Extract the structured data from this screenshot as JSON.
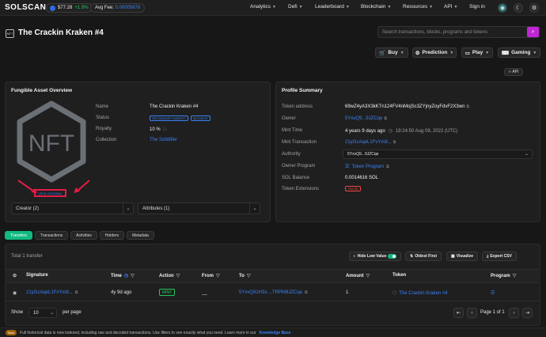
{
  "nav": {
    "logo": "SOLSCAN",
    "sol_price": "$77.28",
    "sol_change": "+1.9%",
    "avg_fee_label": "Avg Fee:",
    "avg_fee_value": "0.00005676",
    "items": [
      "Analytics",
      "Defi",
      "Leaderboard",
      "Blockchain",
      "Resources",
      "API"
    ],
    "signin": "Sign in"
  },
  "title": {
    "badge": "NFT",
    "name": "The Crackin Kraken #4"
  },
  "search": {
    "placeholder": "Search transactions, blocks, programs and tokens"
  },
  "toolbar": {
    "buy": "Buy",
    "prediction": "Prediction",
    "play": "Play",
    "gaming": "Gaming",
    "api": "API"
  },
  "overview": {
    "title": "Fungible Asset Overview",
    "image_text": "NFT",
    "view_original": "VIEW ORIGINAL",
    "rows": [
      {
        "label": "Name",
        "value": "The Crackin Kraken #4"
      },
      {
        "label": "Status",
        "badge1": "SECONDARY MARKET",
        "badge2": "MUTABLE"
      },
      {
        "label": "Royalty",
        "value": "10 %"
      },
      {
        "label": "Collection",
        "value": "The Solidifier"
      }
    ],
    "creator_select": "Creator (2)",
    "attributes_select": "Attributes (1)"
  },
  "profile": {
    "title": "Profile Summary",
    "rows": [
      {
        "label": "Token address",
        "value": "69wZ4yA3X3kKTn124FV4nMojSc3ZYjnyZoyFdvF2X3wn"
      },
      {
        "label": "Owner",
        "value": "5YxvQ9...9JZCqe"
      },
      {
        "label": "Mint Time",
        "value": "4 years 9 days ago",
        "extra": "19:24:50 Aug 09, 2022 (UTC)"
      },
      {
        "label": "Mint Transaction",
        "value": "21yGcAqeL1FvYm8..."
      },
      {
        "label": "Authority",
        "value": "5YxvQ9...9JZCqe"
      },
      {
        "label": "Owner Program",
        "value": "Token Program"
      },
      {
        "label": "SOL Balance",
        "value": "0.0014616 SOL"
      },
      {
        "label": "Token Extensions",
        "value": "FALSE"
      }
    ]
  },
  "tabs": [
    "Transfers",
    "Transactions",
    "Activities",
    "Holders",
    "Metadata"
  ],
  "transfers": {
    "total": "Total 1 transfer",
    "hide_low_value": "Hide Low Value",
    "oldest_first": "Oldest First",
    "visualize": "Visualize",
    "export_csv": "Export CSV",
    "columns": [
      "Signature",
      "Time",
      "Action",
      "From",
      "To",
      "Amount",
      "Token",
      "Program"
    ],
    "rows": [
      {
        "signature": "21yGcAqeL1FvYm8...",
        "time": "4y 9d ago",
        "action": "MINT",
        "from": "__",
        "to": "5YxvQ91H3x....TRPM9JZCqe",
        "amount": "1",
        "token": "The Crackin Kraken #4"
      }
    ],
    "show_label": "Show",
    "per_page_value": "10",
    "per_page_label": "per page",
    "page_info": "Page 1 of 1"
  },
  "footer": {
    "new_badge": "New",
    "message": "Full historical data is now indexed, including raw and decoded transactions. Use filters to see exactly what you need. Learn more in our",
    "link": "Knowledge Base"
  }
}
